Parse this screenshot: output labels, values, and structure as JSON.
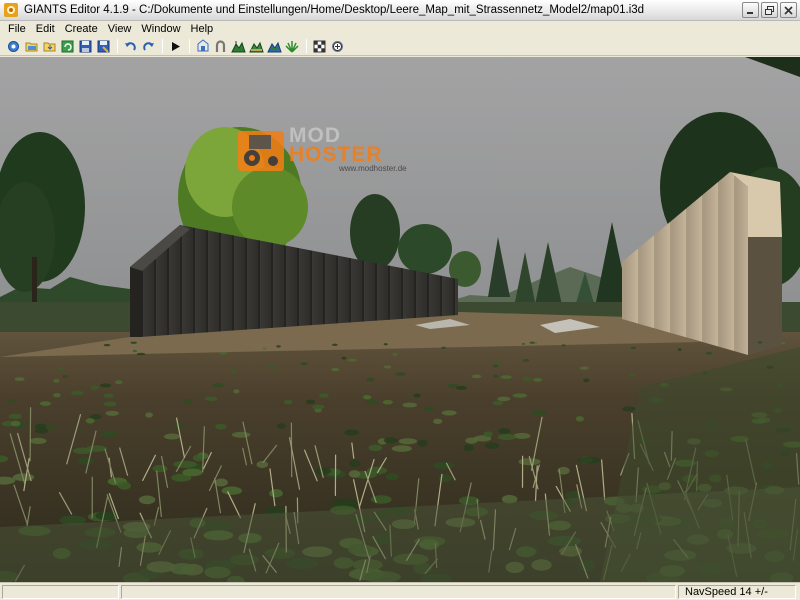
{
  "window": {
    "title": "GIANTS Editor 4.1.9 - C:/Dokumente und Einstellungen/Home/Desktop/Leere_Map_mit_Strassennetz_Model2/map01.i3d"
  },
  "menu": [
    {
      "name": "menu-file",
      "label": "File"
    },
    {
      "name": "menu-edit",
      "label": "Edit"
    },
    {
      "name": "menu-create",
      "label": "Create"
    },
    {
      "name": "menu-view",
      "label": "View"
    },
    {
      "name": "menu-window",
      "label": "Window"
    },
    {
      "name": "menu-help",
      "label": "Help"
    }
  ],
  "toolbar": {
    "icons": [
      "new-icon",
      "open-icon",
      "import-icon",
      "reload-icon",
      "save-icon",
      "save-as-icon",
      "undo-icon",
      "redo-icon",
      "play-icon",
      "select-icon",
      "move-icon",
      "terrain-sculpt-icon",
      "terrain-paint-icon",
      "terrain-detail-icon",
      "foliage-paint-icon",
      "texture-paint-icon",
      "settings-icon"
    ]
  },
  "viewport": {
    "watermark": {
      "line1": "MOD",
      "line2": "HOSTER",
      "url": "www.modhoster.de"
    }
  },
  "status": {
    "navspeed": "NavSpeed 14 +/-"
  },
  "colors": {
    "watermark_orange": "#f57d14",
    "sky": "#9a9a9b",
    "toolbar_bg": "#ece9d8"
  }
}
